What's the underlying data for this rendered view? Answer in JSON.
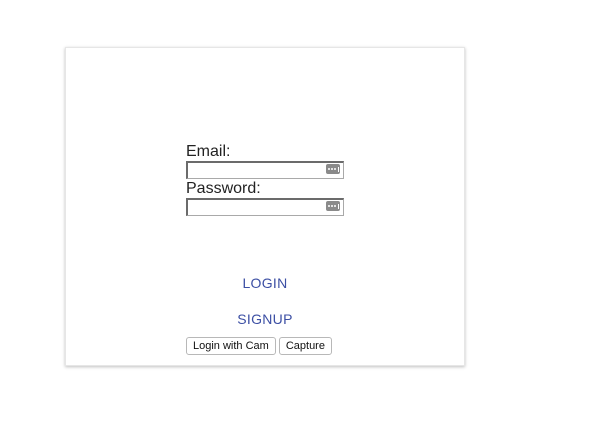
{
  "login_form": {
    "email_label": "Email:",
    "email_value": "",
    "password_label": "Password:",
    "password_value": "",
    "login_label": "LOGIN",
    "signup_label": "SIGNUP",
    "login_with_cam_label": "Login with Cam",
    "capture_label": "Capture"
  },
  "icons": {
    "email_field_icon": "password-manager-key-icon",
    "password_field_icon": "password-manager-key-icon"
  },
  "colors": {
    "link": "#3c4fa4",
    "card_background": "#ffffff",
    "page_background": "#ffffff"
  }
}
